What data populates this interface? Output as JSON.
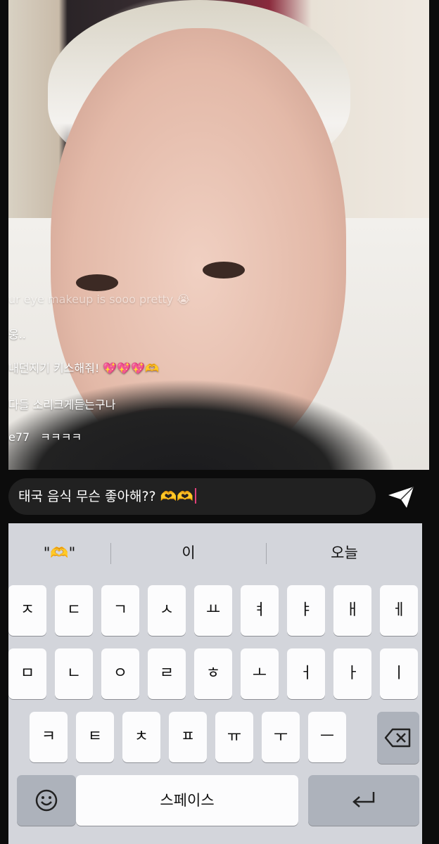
{
  "comments": [
    {
      "user": "",
      "text": "ur eye makeup is sooo pretty 😭"
    },
    {
      "user": "",
      "text": "웅.."
    },
    {
      "user": "",
      "text": "내던지기 키스해줘! 💖💖💖🫶"
    },
    {
      "user": "",
      "text": "다들 소리크게듣는구나"
    },
    {
      "user": "e77",
      "text": "ㅋㅋㅋㅋ"
    }
  ],
  "chat_input": {
    "value": "태국 음식 무슨 좋아해?? 🫶🫶"
  },
  "suggestions": [
    "\"🫶\"",
    "이",
    "오늘"
  ],
  "keyboard": {
    "row1": [
      "ㅈ",
      "ㄷ",
      "ㄱ",
      "ㅅ",
      "ㅛ",
      "ㅕ",
      "ㅑ",
      "ㅐ",
      "ㅔ"
    ],
    "row2": [
      "ㅁ",
      "ㄴ",
      "ㅇ",
      "ㄹ",
      "ㅎ",
      "ㅗ",
      "ㅓ",
      "ㅏ",
      "ㅣ"
    ],
    "row3": [
      "ㅋ",
      "ㅌ",
      "ㅊ",
      "ㅍ",
      "ㅠ",
      "ㅜ",
      "ㅡ"
    ],
    "space_label": "스페이스",
    "emoji_icon": "emoji-icon",
    "backspace_icon": "backspace-icon",
    "return_icon": "return-icon"
  },
  "colors": {
    "caret": "#e0407a",
    "keyboard_bg": "#d3d5db"
  }
}
